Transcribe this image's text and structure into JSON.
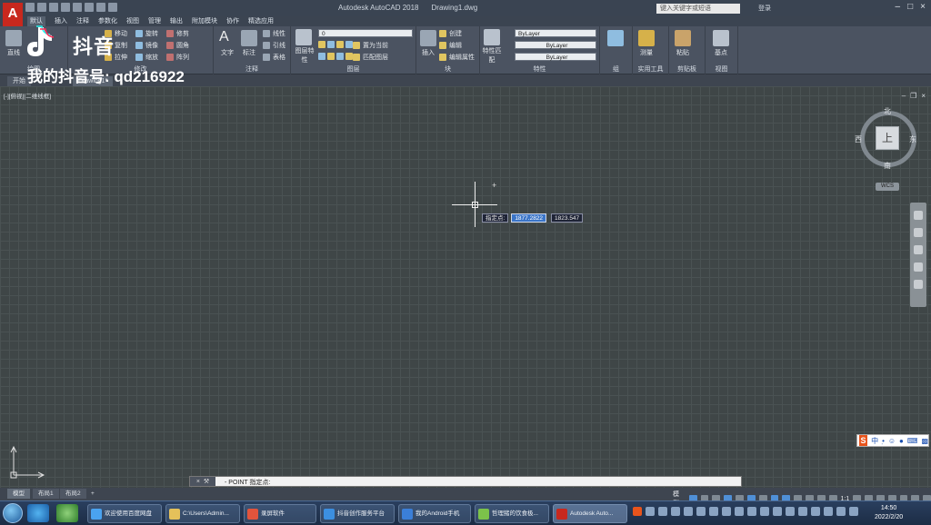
{
  "titlebar": {
    "app_name": "Autodesk AutoCAD 2018",
    "document": "Drawing1.dwg",
    "search_placeholder": "键入关键字或短语",
    "user": "登录",
    "logo_letter": "A"
  },
  "tabs": [
    "默认",
    "插入",
    "注释",
    "参数化",
    "视图",
    "管理",
    "输出",
    "附加模块",
    "协作",
    "精选应用"
  ],
  "ribbon": {
    "modify": {
      "rows": [
        [
          "移动",
          "旋转",
          "修剪"
        ],
        [
          "复制",
          "镜像",
          "圆角"
        ],
        [
          "拉伸",
          "缩放",
          "阵列"
        ]
      ],
      "title": "修改"
    },
    "draw": {
      "line": "直线",
      "title": "绘图"
    },
    "annotation": {
      "text": "文字",
      "dimension": "标注",
      "rows": [
        "线性",
        "引线",
        "表格"
      ],
      "title": "注释"
    },
    "layers": {
      "layer_props": "图层特性",
      "layer_value": "0",
      "rows": [
        "置为当前",
        "匹配图层"
      ],
      "title": "图层"
    },
    "block": {
      "insert": "插入",
      "rows": [
        "创建",
        "编辑",
        "编辑属性"
      ],
      "title": "块"
    },
    "properties": {
      "match": "特性匹配",
      "combos": [
        "ByLayer",
        "ByLayer",
        "ByLayer"
      ],
      "title": "特性"
    },
    "groups": {
      "title": "组"
    },
    "utilities": {
      "measure": "测量",
      "title": "实用工具"
    },
    "clipboard": {
      "paste": "粘贴",
      "title": "剪贴板"
    },
    "view": {
      "base": "基点",
      "title": "视图"
    }
  },
  "doc_tabs": [
    "开始",
    "Drawing1*"
  ],
  "watermark": {
    "brand": "抖音",
    "id_line": "我的抖音号: qd216922"
  },
  "viewport": {
    "label": "[-][俯视][二维线框]"
  },
  "dynamic_input": {
    "prompt": "指定点:",
    "x_value": "1877.2822",
    "y_value": "1823.547"
  },
  "viewcube": {
    "north": "北",
    "south": "南",
    "east": "东",
    "west": "西",
    "face": "上",
    "wcs": "WCS"
  },
  "command_line": {
    "text": "- POINT 指定点:"
  },
  "layout_tabs": [
    "模型",
    "布局1",
    "布局2"
  ],
  "status": {
    "model": "模型",
    "scale": "1:1"
  },
  "ime": {
    "logo": "S",
    "mode": "中"
  },
  "taskbar": {
    "items": [
      "欢迎使用百度网盘",
      "C:\\Users\\Admin...",
      "录屏软件",
      "抖音创作服务平台",
      "我的Android手机",
      "哲理猪的饮食极...",
      "Autodesk Auto..."
    ],
    "time": "14:50",
    "date": "2022/2/20"
  },
  "colors": {
    "canvas": "#3f4647",
    "grid": "#4a5253",
    "ribbon": "#4b5361",
    "accent": "#c8281e"
  }
}
